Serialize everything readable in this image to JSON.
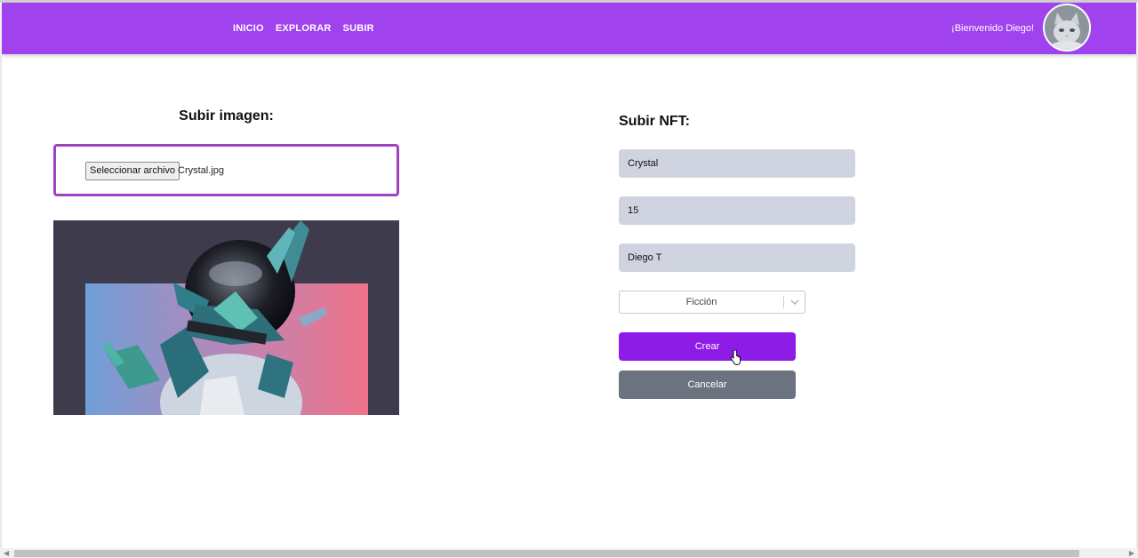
{
  "nav": {
    "links": [
      "INICIO",
      "EXPLORAR",
      "SUBIR"
    ],
    "welcome": "¡Bienvenido Diego!",
    "avatar_icon": "cat-avatar",
    "bar_color": "#a042ee"
  },
  "upload_image": {
    "title": "Subir imagen:",
    "file_button_label": "Seleccionar archivo",
    "file_name": "Crystal.jpg",
    "preview_icon": "crystal-astronaut-image"
  },
  "upload_nft": {
    "title": "Subir NFT:",
    "fields": [
      "Crystal",
      "15",
      "Diego T"
    ],
    "category_selected": "Ficción",
    "create_label": "Crear",
    "cancel_label": "Cancelar",
    "create_color": "#8d1ce6",
    "cancel_color": "#6b7280"
  }
}
